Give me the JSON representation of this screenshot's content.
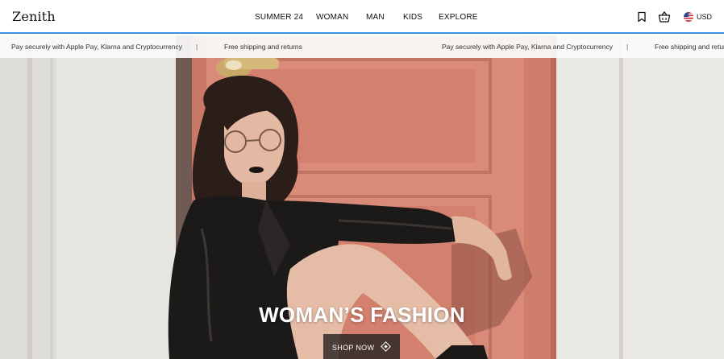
{
  "brand": {
    "logo_text": "Zenith"
  },
  "nav": {
    "items": [
      "SUMMER 24",
      "WOMAN",
      "MAN",
      "KIDS",
      "EXPLORE"
    ]
  },
  "header_icons": {
    "bookmark": "bookmark-icon",
    "basket": "basket-icon",
    "flag": "us-flag-icon"
  },
  "currency": {
    "label": "USD"
  },
  "promo": {
    "messages": [
      "Pay securely with Apple Pay, Klarna and Cryptocurrency",
      "Free shipping and returns",
      "Pay securely with Apple Pay, Klarna and Cryptocurrency",
      "Free shipping and returns"
    ],
    "separator": "|"
  },
  "hero": {
    "title": "WOMAN’S FASHION",
    "cta_label": "SHOP NOW",
    "cta_icon": "diamond-icon"
  },
  "colors": {
    "accent_line": "#3b93e6",
    "door": "#d88573",
    "wall": "#e9e7e3",
    "jacket": "#1a1817"
  }
}
